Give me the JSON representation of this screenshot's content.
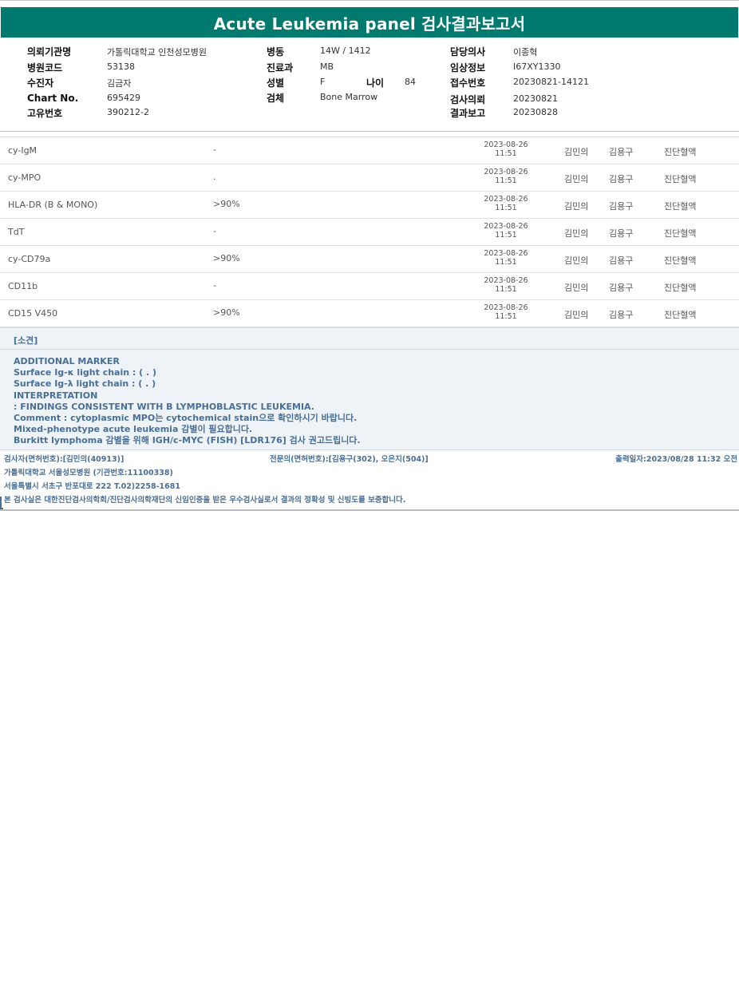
{
  "title": "Acute Leukemia panel 검사결과보고서",
  "header": {
    "col1": [
      {
        "label": "의뢰기관명",
        "value": "가톨릭대학교 인천성모병원"
      },
      {
        "label": "병원코드",
        "value": "53138"
      },
      {
        "label": "수진자",
        "value": "김금자"
      },
      {
        "label": "Chart No.",
        "value": "695429"
      },
      {
        "label": "고유번호",
        "value": "390212-2"
      }
    ],
    "col2": [
      {
        "label": "병동",
        "value": "14W / 1412"
      },
      {
        "label": "진료과",
        "value": "MB"
      },
      {
        "label": "성별",
        "value": "F"
      },
      {
        "label": "검체",
        "value": "Bone Marrow"
      }
    ],
    "age": {
      "label": "나이",
      "value": "84"
    },
    "col3": [
      {
        "label": "담당의사",
        "value": "이종혁"
      },
      {
        "label": "임상정보",
        "value": "I67XY1330"
      },
      {
        "label": "접수번호",
        "value": "20230821-14121"
      },
      {
        "label": "검사의뢰",
        "value": "20230821"
      },
      {
        "label": "결과보고",
        "value": "20230828"
      }
    ]
  },
  "results": [
    {
      "name": "cy-IgM",
      "value": "-",
      "date": "2023-08-26",
      "time": "11:51",
      "tester": "김민의",
      "doctor": "김용구",
      "dept": "진단혈액"
    },
    {
      "name": "cy-MPO",
      "value": ".",
      "date": "2023-08-26",
      "time": "11:51",
      "tester": "김민의",
      "doctor": "김용구",
      "dept": "진단혈액"
    },
    {
      "name": "HLA-DR (B & MONO)",
      "value": ">90%",
      "date": "2023-08-26",
      "time": "11:51",
      "tester": "김민의",
      "doctor": "김용구",
      "dept": "진단혈액"
    },
    {
      "name": "TdT",
      "value": "-",
      "date": "2023-08-26",
      "time": "11:51",
      "tester": "김민의",
      "doctor": "김용구",
      "dept": "진단혈액"
    },
    {
      "name": "cy-CD79a",
      "value": ">90%",
      "date": "2023-08-26",
      "time": "11:51",
      "tester": "김민의",
      "doctor": "김용구",
      "dept": "진단혈액"
    },
    {
      "name": "CD11b",
      "value": "-",
      "date": "2023-08-26",
      "time": "11:51",
      "tester": "김민의",
      "doctor": "김용구",
      "dept": "진단혈액"
    },
    {
      "name": "CD15 V450",
      "value": ">90%",
      "date": "2023-08-26",
      "time": "11:51",
      "tester": "김민의",
      "doctor": "김용구",
      "dept": "진단혈액"
    }
  ],
  "opinion": {
    "heading": "[소견]",
    "lines": [
      "ADDITIONAL MARKER",
      "Surface Ig-κ light chain : ( . )",
      "Surface Ig-λ light chain : ( . )",
      "INTERPRETATION",
      ": FINDINGS CONSISTENT WITH B LYMPHOBLASTIC LEUKEMIA.",
      "Comment : cytoplasmic MPO는 cytochemical stain으로 확인하시기 바랍니다.",
      "Mixed-phenotype acute leukemia 감별이 필요합니다.",
      "Burkitt lymphoma 감별을 위해 IGH/c-MYC (FISH) [LDR176] 검사 권고드립니다."
    ]
  },
  "footer": {
    "tester": "검사자(면허번호):[김민의(40913)]",
    "specialist": "전문의(면허번호):[김용구(302), 오은지(504)]",
    "printed": "출력일자:2023/08/28 11:32 오전",
    "hospital": "가톨릭대학교 서울성모병원 (기관번호:11100338)",
    "address": "서울특별시 서초구 반포대로 222 T.02)2258-1681",
    "certification": "본 검사실은 대한진단검사의학회/진단검사의학재단의 신임인증을 받은 우수검사실로서 결과의 정확성 및 신빙도를 보증합니다."
  }
}
